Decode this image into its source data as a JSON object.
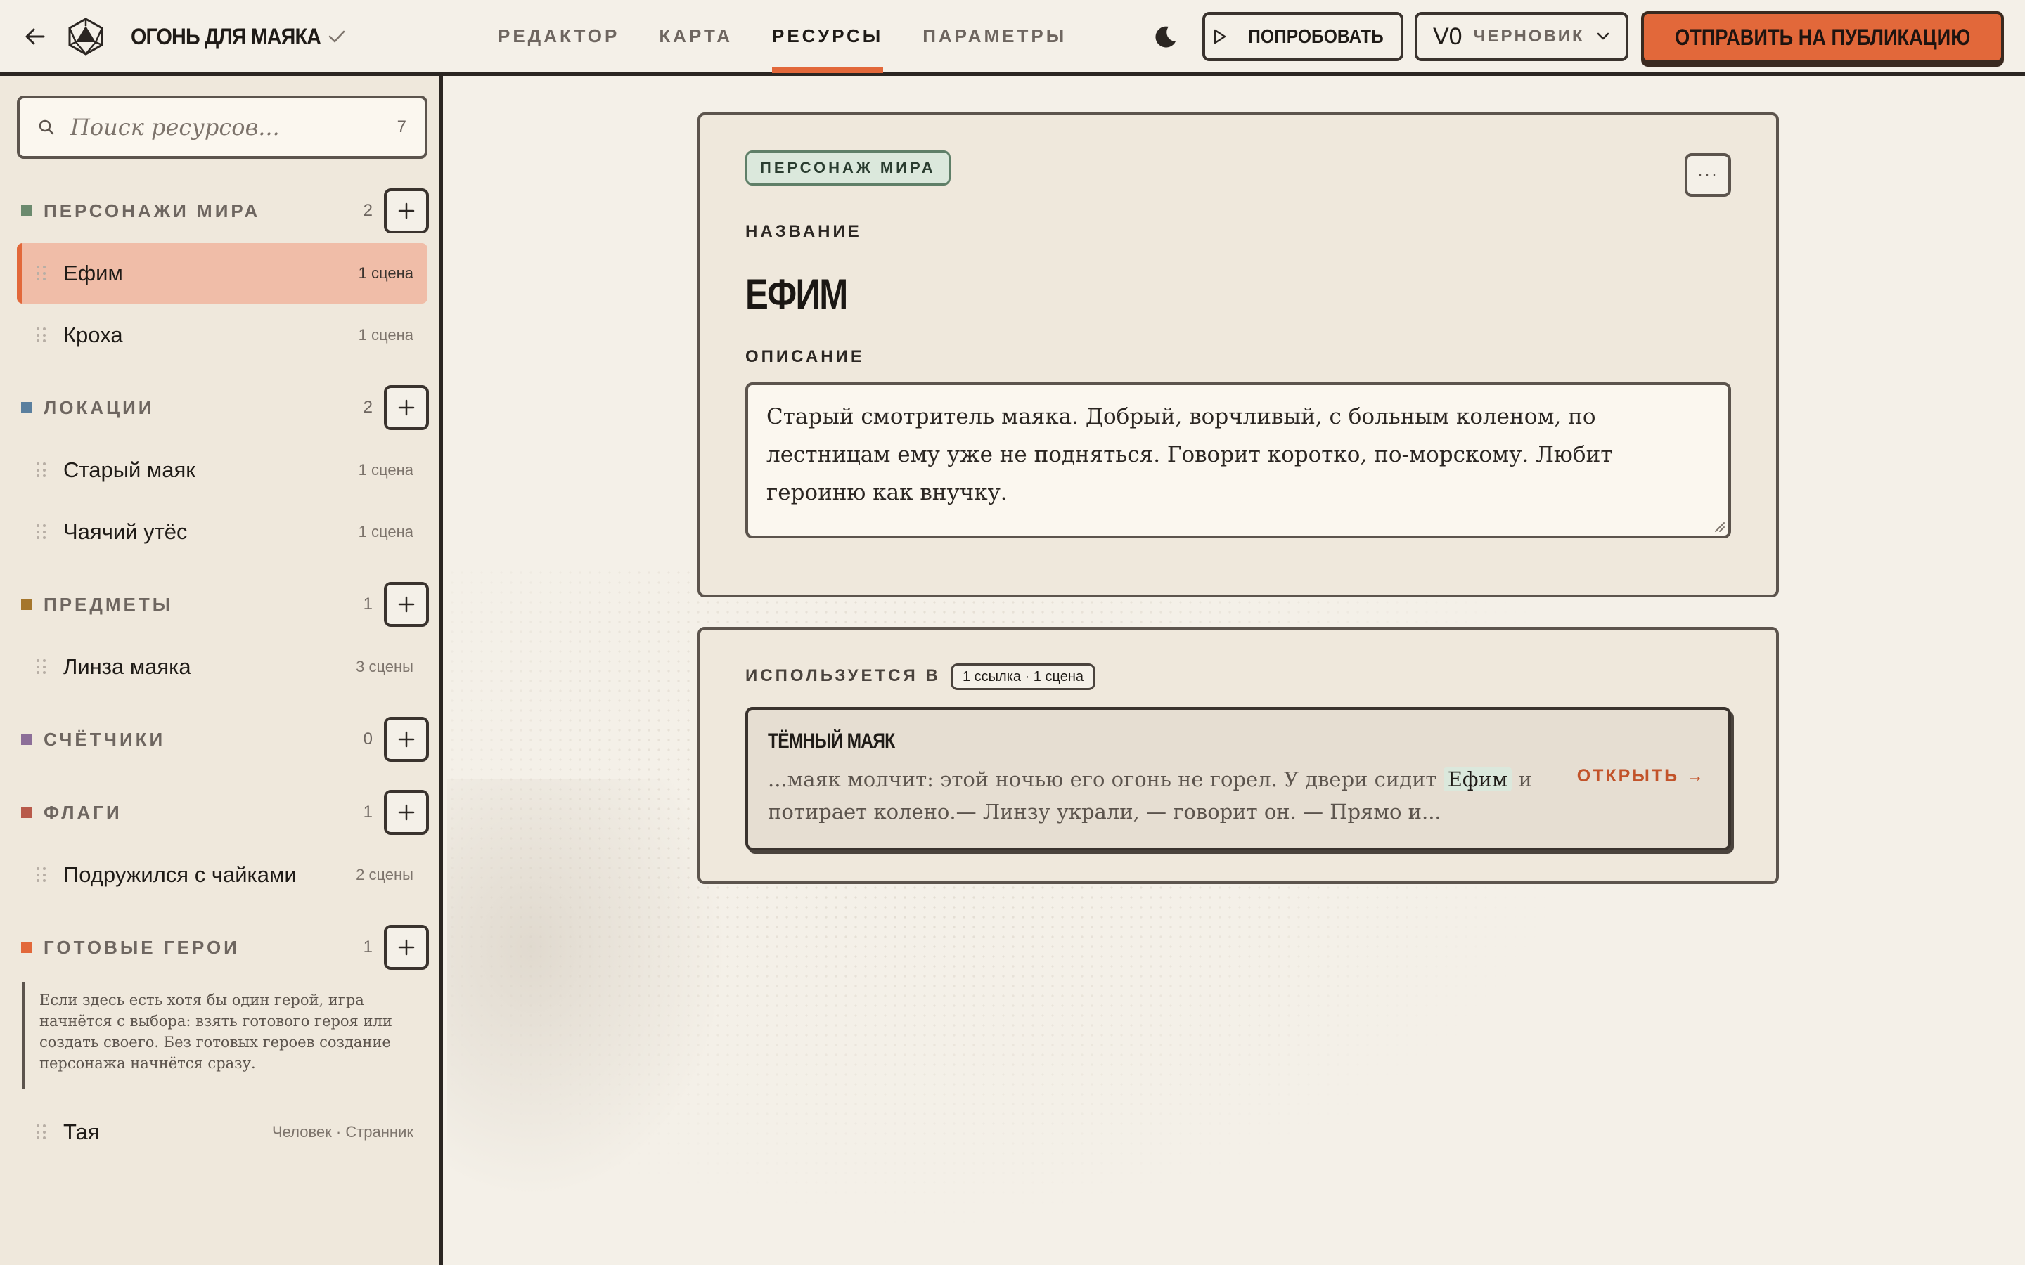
{
  "header": {
    "title": "ОГОНЬ ДЛЯ МАЯКА",
    "tabs": [
      {
        "label": "РЕДАКТОР"
      },
      {
        "label": "КАРТА"
      },
      {
        "label": "РЕСУРСЫ",
        "active": true
      },
      {
        "label": "ПАРАМЕТРЫ"
      }
    ],
    "try_label": "ПОПРОБОВАТЬ",
    "version": "V0",
    "version_status": "ЧЕРНОВИК",
    "publish_label": "ОТПРАВИТЬ НА ПУБЛИКАЦИЮ"
  },
  "sidebar": {
    "search": {
      "placeholder": "Поиск ресурсов...",
      "count": "7"
    },
    "sections": [
      {
        "title": "ПЕРСОНАЖИ МИРА",
        "count": "2",
        "color": "#6b8a6e",
        "items": [
          {
            "label": "Ефим",
            "meta": "1 сцена",
            "active": true
          },
          {
            "label": "Кроха",
            "meta": "1 сцена"
          }
        ]
      },
      {
        "title": "ЛОКАЦИИ",
        "count": "2",
        "color": "#5a7f9e",
        "items": [
          {
            "label": "Старый маяк",
            "meta": "1 сцена"
          },
          {
            "label": "Чаячий утёс",
            "meta": "1 сцена"
          }
        ]
      },
      {
        "title": "ПРЕДМЕТЫ",
        "count": "1",
        "color": "#a5762c",
        "items": [
          {
            "label": "Линза маяка",
            "meta": "3 сцены"
          }
        ]
      },
      {
        "title": "СЧЁТЧИКИ",
        "count": "0",
        "color": "#8c6e98",
        "items": []
      },
      {
        "title": "ФЛАГИ",
        "count": "1",
        "color": "#b85a4a",
        "items": [
          {
            "label": "Подружился с чайками",
            "meta": "2 сцены"
          }
        ]
      },
      {
        "title": "ГОТОВЫЕ ГЕРОИ",
        "count": "1",
        "color": "#e2683a",
        "items": [
          {
            "label": "Тая",
            "meta": "Человек · Странник"
          }
        ]
      }
    ],
    "heroes_note": "Если здесь есть хотя бы один герой, игра начнётся с выбора: взять готового героя или создать своего. Без готовых героев создание персонажа начнётся сразу."
  },
  "resource": {
    "type_badge": "ПЕРСОНАЖ МИРА",
    "name_label": "НАЗВАНИЕ",
    "name": "ЕФИМ",
    "desc_label": "ОПИСАНИЕ",
    "description": "Старый смотритель маяка. Добрый, ворчливый, с больным коленом, по лестницам ему уже не подняться. Говорит коротко, по-морскому. Любит героиню как внучку.",
    "more_label": "···"
  },
  "usage": {
    "title": "ИСПОЛЬЗУЕТСЯ В",
    "badge": "1 ссылка · 1 сцена",
    "refs": [
      {
        "title": "ТЁМНЫЙ МАЯК",
        "text_before": "...маяк молчит: этой ночью его огонь не горел. У двери сидит ",
        "mention": "Ефим",
        "text_after": " и потирает колено.— Линзу украли, — говорит он. — Прямо и...",
        "open_label": "ОТКРЫТЬ →"
      }
    ]
  },
  "icons": {
    "back": "arrow-left-icon",
    "logo": "d20-dice-icon",
    "check": "check-icon",
    "theme": "moon-icon",
    "play": "play-icon",
    "chevron": "chevron-down-icon",
    "search": "search-icon",
    "add": "plus-icon",
    "grip": "drag-handle-icon"
  },
  "colors": {
    "accent": "#e2683a",
    "ink": "#2b2622",
    "paper": "#f4f0e8"
  }
}
